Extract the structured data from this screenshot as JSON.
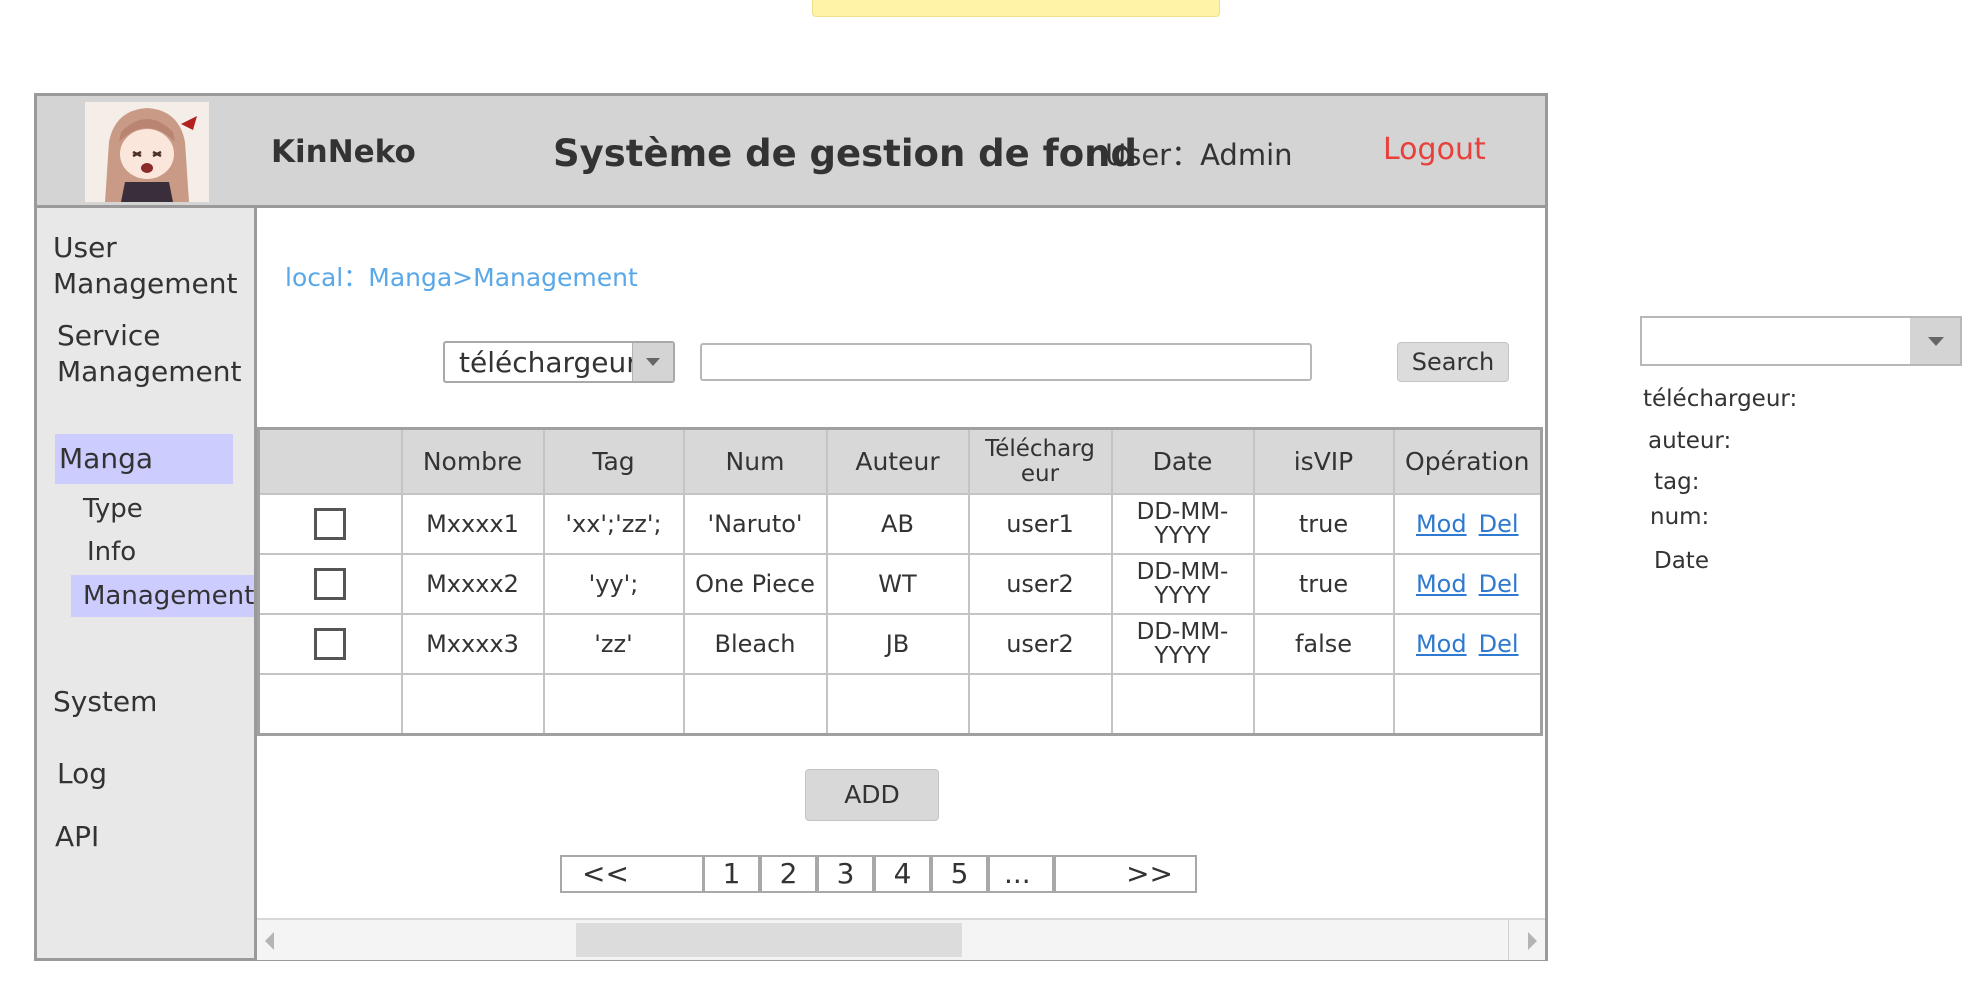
{
  "header": {
    "app_name": "KinNeko",
    "title": "Système de gestion de fond",
    "user": "User：Admin",
    "logout": "Logout"
  },
  "sidebar": {
    "user_management": "User Management",
    "service_management": "Service Management",
    "manga": "Manga",
    "sub_items": [
      "Type",
      "Info",
      "Management"
    ],
    "system": "System",
    "log": "Log",
    "api": "API"
  },
  "breadcrumb": "local：Manga>Management",
  "filter": {
    "selected": "téléchargeur",
    "search_value": "",
    "search_label": "Search"
  },
  "table": {
    "headers": [
      "",
      "Nombre",
      "Tag",
      "Num",
      "Auteur",
      "Télécharg eur",
      "Date",
      "isVIP",
      "Opération"
    ],
    "rows": [
      {
        "nombre": "Mxxxx1",
        "tag": "'xx';'zz';",
        "num": "'Naruto'",
        "auteur": "AB",
        "telechargeur": "user1",
        "date": "DD-MM-YYYY",
        "isvip": "true"
      },
      {
        "nombre": "Mxxxx2",
        "tag": "'yy';",
        "num": "One Piece",
        "auteur": "WT",
        "telechargeur": "user2",
        "date": "DD-MM-YYYY",
        "isvip": "true"
      },
      {
        "nombre": "Mxxxx3",
        "tag": "'zz'",
        "num": "Bleach",
        "auteur": "JB",
        "telechargeur": "user2",
        "date": "DD-MM-YYYY",
        "isvip": "false"
      }
    ],
    "mod_label": "Mod",
    "del_label": "Del"
  },
  "add_label": "ADD",
  "pagination": {
    "prev": "<<",
    "pages": [
      "1",
      "2",
      "3",
      "4",
      "5"
    ],
    "ellipsis": "...",
    "next": ">>"
  },
  "right_panel": {
    "selected": "",
    "options": [
      "téléchargeur:",
      "auteur:",
      "tag:",
      "num:",
      "Date"
    ]
  }
}
